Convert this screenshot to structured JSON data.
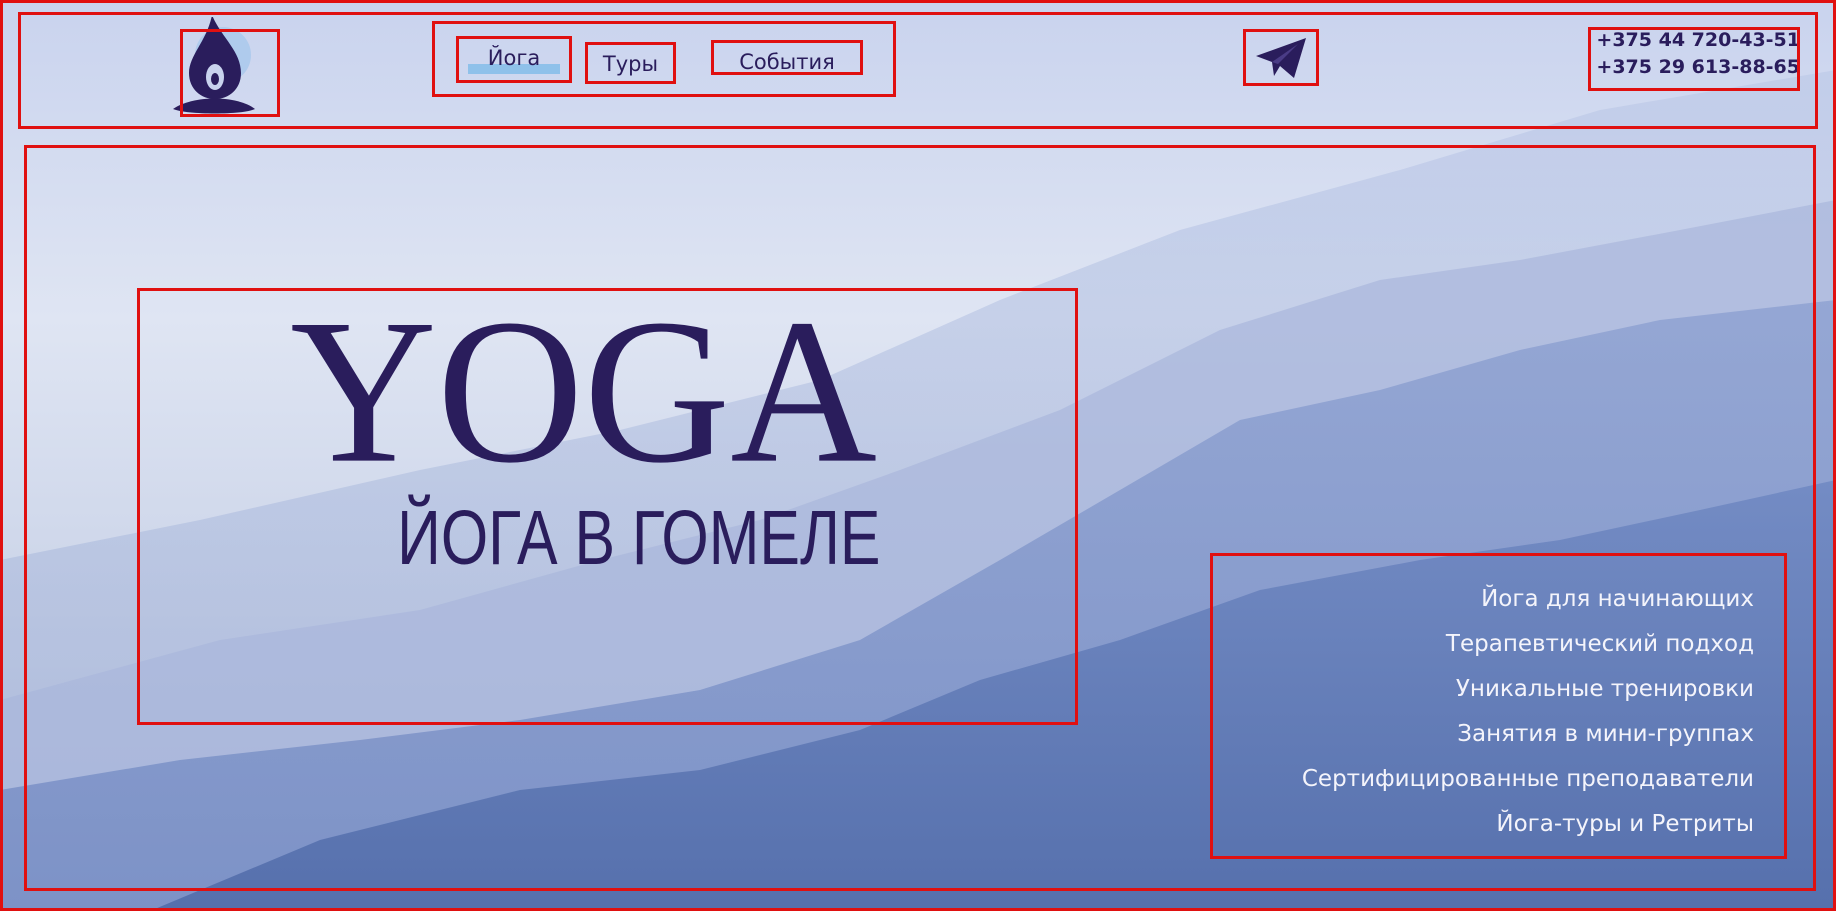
{
  "header": {
    "logo_icon": "yoga-drop-logo-icon",
    "nav": [
      {
        "label": "Йога",
        "active": true
      },
      {
        "label": "Туры",
        "active": false
      },
      {
        "label": "События",
        "active": false
      }
    ],
    "telegram_icon": "telegram-plane-icon",
    "phones": [
      "+375 44 720-43-51",
      "+375 29 613-88-65"
    ]
  },
  "hero": {
    "title": "YOGA",
    "subtitle": "ЙОГА В ГОМЕЛЕ",
    "features": [
      "Йога для начинающих",
      "Терапевтический подход",
      "Уникальные тренировки",
      "Занятия в мини-группах",
      "Сертифицированные преподаватели",
      "Йога-туры и Ретриты"
    ]
  },
  "colors": {
    "accent_dark": "#2a1d5c",
    "nav_highlight": "#8fc1ea",
    "annotation_red": "#e01010",
    "feature_text": "#f4f4fb"
  }
}
